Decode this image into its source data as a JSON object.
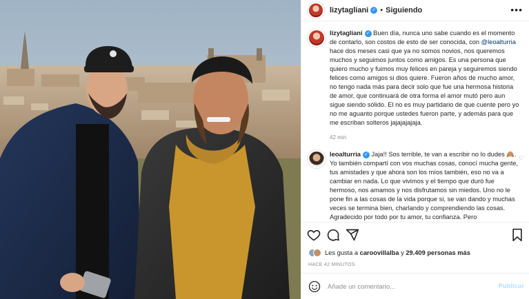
{
  "post": {
    "photo_description_icon": "photo",
    "username": "lizytagliani",
    "separator": "•",
    "follow_status": "Siguiendo",
    "more_icon": "more-icon"
  },
  "caption": {
    "username": "lizytagliani",
    "text_before_mention": " Buen día, nunca uno sabe cuando es el momento de contarlo, son costos de esto de ser conocida, con ",
    "mention": "@leoalturria",
    "text_after_mention": " hace dos meses casi que ya no somos novios, nos queremos muchos y seguimos juntos como amigos. Es una persona que quiero mucho y fuimos muy felices en pareja y seguiremos siendo felices como amigos si dios quiere. Fueron años de mucho amor, no tengo nada más para decir solo que fue una hermosa historia de amor, que continuará de otra forma el amor mutó pero aun sigue siendo sólido. El no es muy partidario de que cuente pero yo no me aguanto porque ustedes fueron parte, y además para que me escriban solteros jajajajajaja.",
    "time": "42 min"
  },
  "reply": {
    "username": "leoalturria",
    "text": " Jaja!! Sos terrible, te van a escribir no lo dudes 🙈. Yo también compartí con vos muchas cosas, conocí mucha gente, tus amistades y que ahora son los míos también, eso no va a cambiar en nada. Lo que vivimos y el tiempo que duró fue hermoso, nos amamos y nos disfrutamos sin miedos. Uno no le pone fin a las cosas de la vida porque si, se van dando y muchas veces se termina bien, charlando y comprendiendo las cosas. Agradecido por todo por tu amor, tu confianza. Pero"
  },
  "actions": {
    "likes_prefix": "Les gusta a ",
    "likes_user": "caroovillalba",
    "likes_middle": " y ",
    "likes_count": "29.409 personas más",
    "time_ago": "HACE 42 MINUTOS",
    "comment_placeholder": "Añade un comentario...",
    "publish_label": "Publicar"
  },
  "colors": {
    "verified": "#3897f0",
    "mention": "#00376b",
    "publish_disabled": "#b2dffc",
    "muted": "#8e8e8e"
  }
}
